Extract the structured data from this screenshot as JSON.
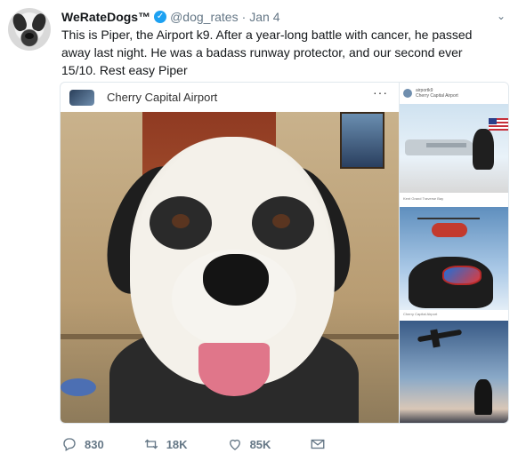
{
  "tweet": {
    "display_name": "WeRateDogs™",
    "handle": "@dog_rates",
    "separator": "·",
    "date": "Jan 4",
    "text": "This is Piper, the Airport k9. After a year-long battle with cancer, he passed away last night. He was a badass runway protector, and our second ever 15/10. Rest easy Piper"
  },
  "media": {
    "main_title": "Cherry Capital Airport",
    "more": "···",
    "side_account": "airportk9",
    "side_subtitle": "Cherry Capital Airport",
    "caption_1": "Kent Grand Traverse Bay",
    "caption_2": "Cherry Capital Airport"
  },
  "actions": {
    "replies": "830",
    "retweets": "18K",
    "likes": "85K"
  },
  "icons": {
    "verified": "verified-badge-icon",
    "chevron": "chevron-down-icon",
    "reply": "reply-icon",
    "retweet": "retweet-icon",
    "like": "heart-icon",
    "dm": "envelope-icon"
  },
  "colors": {
    "accent": "#1da1f2",
    "muted": "#657786",
    "text": "#14171a"
  }
}
